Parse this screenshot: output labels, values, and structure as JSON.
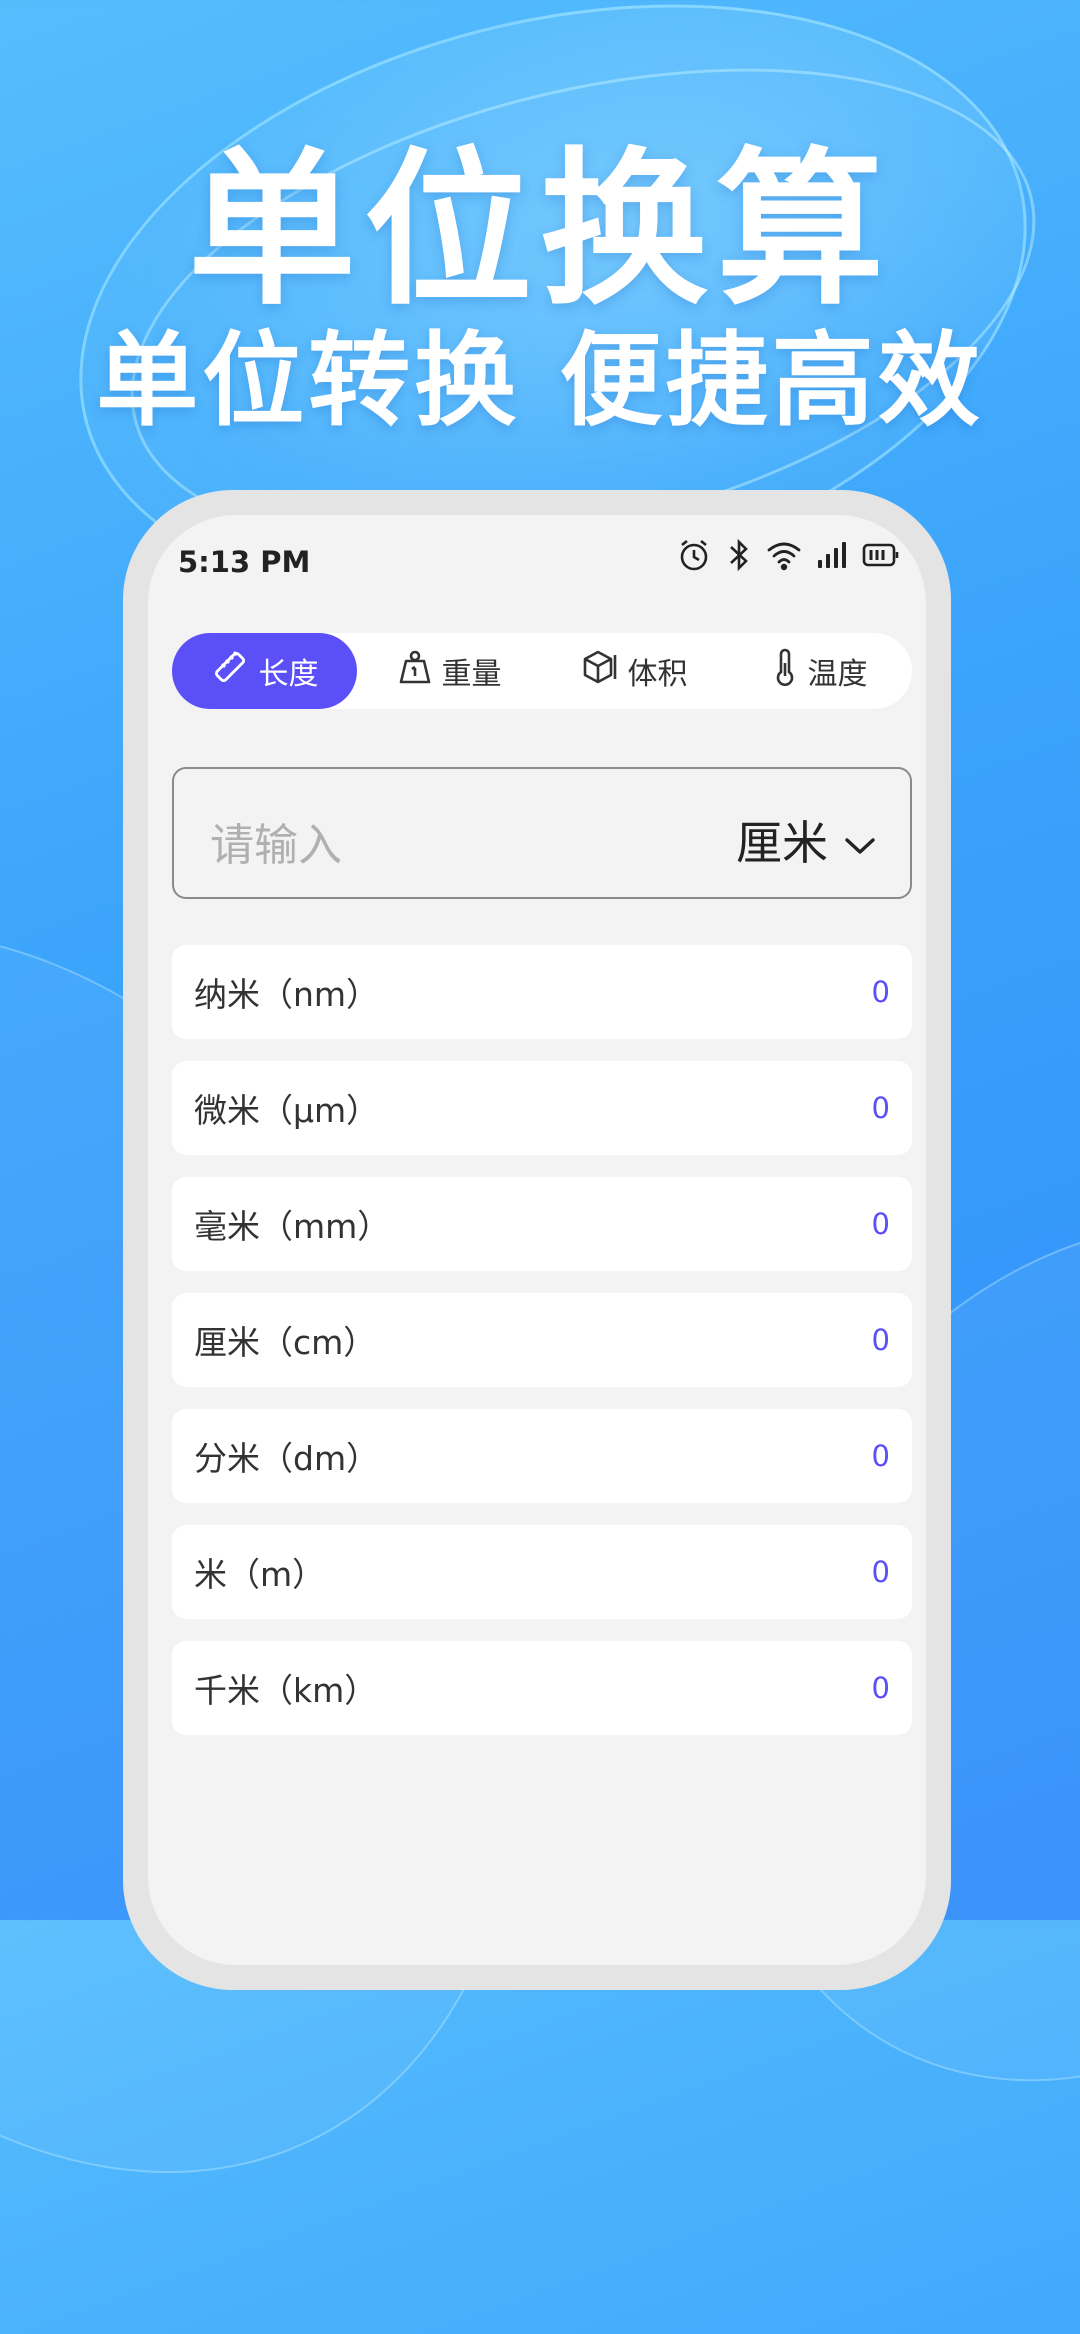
{
  "hero": {
    "title": "单位换算",
    "subtitle": "单位转换 便捷高效"
  },
  "status_bar": {
    "time": "5:13 PM",
    "icons": [
      "alarm-icon",
      "bluetooth-icon",
      "wifi-icon",
      "signal-icon",
      "battery-icon"
    ]
  },
  "tabs": [
    {
      "label": "长度",
      "icon": "ruler-icon",
      "active": true
    },
    {
      "label": "重量",
      "icon": "weight-icon",
      "active": false
    },
    {
      "label": "体积",
      "icon": "cube-icon",
      "active": false
    },
    {
      "label": "温度",
      "icon": "thermometer-icon",
      "active": false
    }
  ],
  "input": {
    "placeholder": "请输入",
    "value": "",
    "selected_unit": "厘米"
  },
  "results": [
    {
      "label": "纳米（nm）",
      "value": "0"
    },
    {
      "label": "微米（μm）",
      "value": "0"
    },
    {
      "label": "毫米（mm）",
      "value": "0"
    },
    {
      "label": "厘米（cm）",
      "value": "0"
    },
    {
      "label": "分米（dm）",
      "value": "0"
    },
    {
      "label": "米（m）",
      "value": "0"
    },
    {
      "label": "千米（km）",
      "value": "0"
    }
  ],
  "colors": {
    "accent": "#5b4ff7",
    "background_top": "#56bdfd",
    "background_bottom": "#2f8cfa"
  }
}
